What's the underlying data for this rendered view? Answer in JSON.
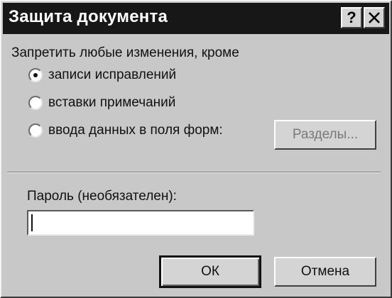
{
  "window": {
    "title": "Защита документа",
    "help_label": "?",
    "close_label": "×"
  },
  "protection": {
    "group_label": "Запретить любые изменения, кроме",
    "options": [
      {
        "label": "записи исправлений",
        "selected": true
      },
      {
        "label": "вставки примечаний",
        "selected": false
      },
      {
        "label": "ввода данных в поля форм:",
        "selected": false
      }
    ],
    "sections_button": "Разделы..."
  },
  "password": {
    "label": "Пароль (необязателен):",
    "value": ""
  },
  "buttons": {
    "ok": "ОК",
    "cancel": "Отмена"
  }
}
